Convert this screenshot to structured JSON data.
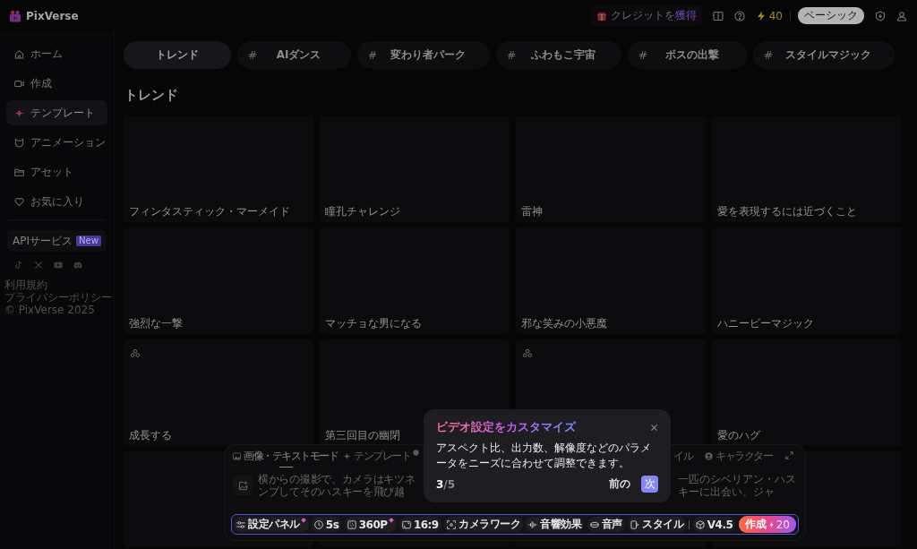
{
  "topbar": {
    "logo": "PixVerse",
    "credits": {
      "text": "クレジットを",
      "highlight": "獲得"
    },
    "energy": "40",
    "plan": "ベーシック"
  },
  "sidebar": {
    "items": [
      {
        "label": "ホーム",
        "selected": false
      },
      {
        "label": "作成",
        "selected": false
      },
      {
        "label": "テンプレート",
        "selected": true
      },
      {
        "label": "アニメーション",
        "selected": false
      },
      {
        "label": "アセット",
        "selected": false
      },
      {
        "label": "お気に入り",
        "selected": false
      }
    ],
    "api": {
      "label": "APIサービス",
      "badge": "New"
    },
    "footer": [
      "利用規約",
      "プライバシーポリシー",
      "© PixVerse 2025"
    ]
  },
  "tabs": [
    {
      "label": "トレンド",
      "selected": true
    },
    {
      "prefix": "#",
      "label": "AIダンス",
      "selected": false
    },
    {
      "prefix": "#",
      "label": "変わり者パーク",
      "selected": false
    },
    {
      "prefix": "#",
      "label": "ふわもこ宇宙",
      "selected": false
    },
    {
      "prefix": "#",
      "label": "ボスの出撃",
      "selected": false
    },
    {
      "prefix": "#",
      "label": "スタイルマジック",
      "selected": false
    }
  ],
  "section_title": "トレンド",
  "cards": [
    {
      "title": "フィンタスティック・マーメイド",
      "group": false
    },
    {
      "title": "瞳孔チャレンジ",
      "group": false
    },
    {
      "title": "雷神",
      "group": false
    },
    {
      "title": "愛を表現するには近づくこと",
      "group": false
    },
    {
      "title": "強烈な一撃",
      "group": false
    },
    {
      "title": "マッチョな男になる",
      "group": false
    },
    {
      "title": "邪な笑みの小悪魔",
      "group": false
    },
    {
      "title": "ハニービーマジック",
      "group": false
    },
    {
      "title": "成長する",
      "group": true
    },
    {
      "title": "第三回目の幽閉",
      "group": false
    },
    {
      "group": true
    },
    {
      "title": "愛のハグ",
      "group": false
    },
    {
      "group": false
    },
    {
      "group": false
    },
    {
      "group": false
    },
    {
      "group": false
    }
  ],
  "panel": {
    "tabs": [
      {
        "kind": "full",
        "label": "画像・テキストモード",
        "selected": true
      },
      {
        "kind": "full",
        "label": "テンプレート",
        "selected": false
      },
      {
        "kind": "icon",
        "selected": false
      },
      {
        "kind": "text",
        "label": "イル",
        "selected": false
      },
      {
        "kind": "full",
        "label": "キャラクター",
        "selected": false
      }
    ],
    "prompt": {
      "left_lines": [
        "横からの撮影で、カメラはキツネ",
        "ンプしてそのハスキーを飛び越"
      ],
      "right": "一匹のシベリアン・ハスキーに出会い、ジャ"
    },
    "toolbar": [
      {
        "kind": "option",
        "label": "設定パネル",
        "premium": true
      },
      {
        "kind": "option",
        "label": "5s",
        "premium": false
      },
      {
        "kind": "option",
        "label": "360P",
        "premium": true
      },
      {
        "kind": "option",
        "label": "16:9",
        "premium": false
      },
      {
        "kind": "option",
        "label": "カメラワーク",
        "premium": false
      },
      {
        "kind": "option",
        "label": "音響効果",
        "premium": false
      },
      {
        "kind": "option",
        "label": "音声",
        "premium": false
      },
      {
        "kind": "option",
        "label": "スタイル",
        "premium": false
      },
      {
        "kind": "divider"
      },
      {
        "kind": "option",
        "label": "V4.5",
        "premium": false
      },
      {
        "kind": "create",
        "label": "作成",
        "cost": "20"
      }
    ]
  },
  "tooltip": {
    "title": "ビデオ設定をカスタマイズ",
    "body": "アスペクト比、出力数、解像度などのパラメータをニーズに合わせて調整できます。",
    "step": "3",
    "step_total": "/5",
    "prev": "前の",
    "next": "次"
  }
}
